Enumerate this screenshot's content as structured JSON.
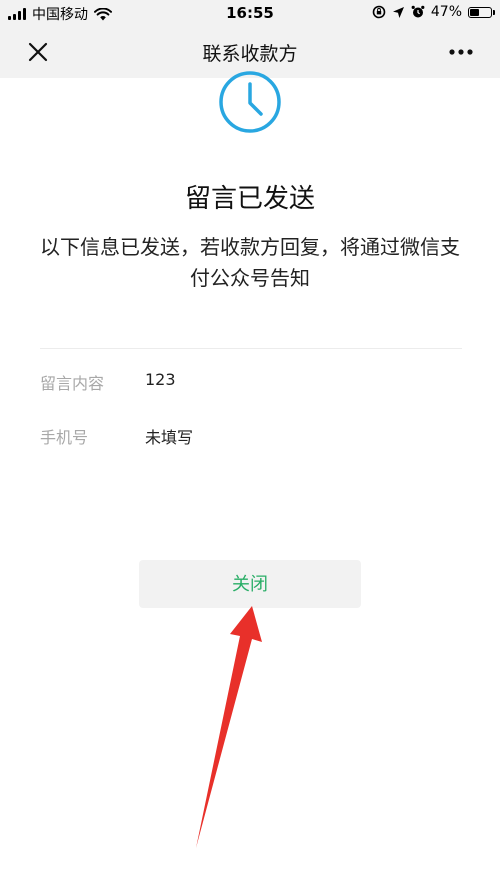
{
  "status_bar": {
    "carrier": "中国移动",
    "time": "16:55",
    "battery": "47%",
    "battery_level": 0.47
  },
  "nav": {
    "title": "联系收款方"
  },
  "result": {
    "title": "留言已发送",
    "description": "以下信息已发送，若收款方回复，将通过微信支付公众号告知"
  },
  "details": [
    {
      "label": "留言内容",
      "value": "123"
    },
    {
      "label": "手机号",
      "value": "未填写"
    }
  ],
  "actions": {
    "close_label": "关闭"
  },
  "colors": {
    "accent": "#2aae67",
    "clock": "#29a7e1",
    "annotation_arrow": "#e8302a"
  },
  "icons": {
    "nav_close": "close-icon",
    "nav_more": "more-icon",
    "result": "clock-icon"
  }
}
